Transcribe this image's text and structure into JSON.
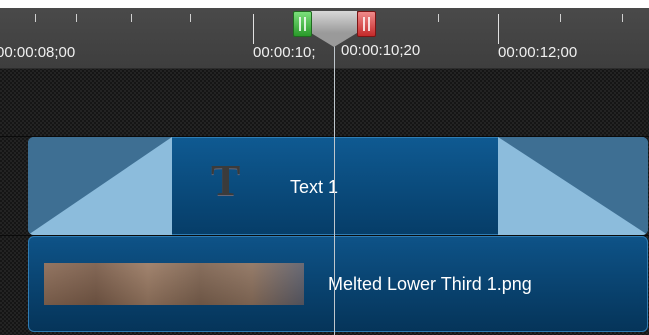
{
  "ruler": {
    "timecodes": [
      "00:00:08;00",
      "00:00:10;",
      "00:00:10;20",
      "00:00:12;00"
    ]
  },
  "playhead": {
    "in_marker": "green",
    "out_marker": "red"
  },
  "tracks": [
    {
      "clip_label": "Text 1",
      "clip_type": "text",
      "icon": "text-t-icon"
    },
    {
      "clip_label": "Melted Lower Third 1.png",
      "clip_type": "image",
      "icon": "image-thumbnail"
    }
  ],
  "colors": {
    "clip_blue": "#0b4c7e",
    "transition": "#3e6f93",
    "in_marker": "#2a9a2a",
    "out_marker": "#c42a2a"
  }
}
